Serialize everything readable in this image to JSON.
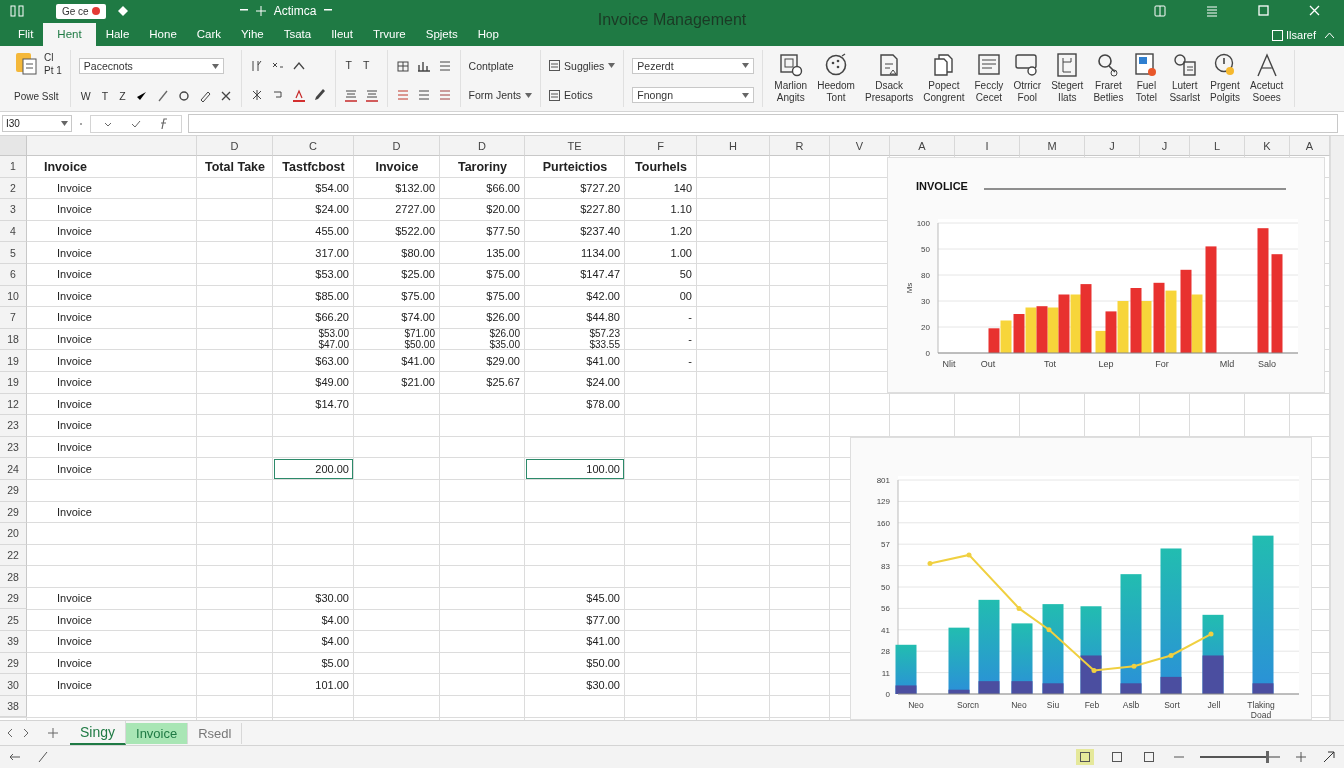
{
  "window": {
    "badge": "Ge ce",
    "document": "Actimca",
    "title": "Invoice Management"
  },
  "menu": {
    "tabs": [
      {
        "label": "Flit",
        "selected": false
      },
      {
        "label": "Hent",
        "selected": true
      },
      {
        "label": "Hale",
        "selected": false
      },
      {
        "label": "Hone",
        "selected": false
      },
      {
        "label": "Cark",
        "selected": false
      },
      {
        "label": "Yihe",
        "selected": false
      },
      {
        "label": "Tsata",
        "selected": false
      },
      {
        "label": "Ileut",
        "selected": false
      },
      {
        "label": "Trvure",
        "selected": false
      },
      {
        "label": "Spjets",
        "selected": false
      },
      {
        "label": "Hop",
        "selected": false
      }
    ],
    "account": {
      "label": "Ilsaref",
      "checked": false
    }
  },
  "ribbon": {
    "paste": {
      "label": "Powe Sslt",
      "small": [
        "Cl",
        "Pt 1"
      ]
    },
    "font": {
      "value": "Pacecnots"
    },
    "letter_buttons": [
      "W",
      "T",
      "Z"
    ],
    "type_buttons": [
      "T",
      "T"
    ],
    "style_commands": [
      {
        "label": "Contplate",
        "dropdown": false
      },
      {
        "label": "Form Jents",
        "dropdown": true
      }
    ],
    "list_commands": [
      {
        "label": "Sugglies",
        "dropdown": true
      },
      {
        "label": "Eotics",
        "dropdown": false
      }
    ],
    "selects": [
      "Pezerdt",
      "Fnongn"
    ],
    "large_buttons": [
      "Marlion\nAngits",
      "Heedom\nTont",
      "Dsack\nPresaports",
      "Popect\nCongrent",
      "Feccly\nCecet",
      "Otrricr\nFool",
      "Stegert\nIlats",
      "Fraret\nBetlies",
      "Fuel\nTotel",
      "Lutert\nSsarlst",
      "Prgent\nPolgits",
      "Acetuct\nSoees"
    ]
  },
  "formula_bar": {
    "name_box": "I30"
  },
  "table": {
    "columns": [
      "D",
      "C",
      "D",
      "D",
      "TE",
      "F",
      "H",
      "R",
      "V",
      "A",
      "I",
      "M",
      "J",
      "J",
      "L",
      "K",
      "A"
    ],
    "header": {
      "label": "1",
      "cells": [
        "Invoice",
        "Total Take",
        "Tastfcbost",
        "Invoice",
        "Taroriny",
        "Purteictios",
        "Tourhels"
      ]
    },
    "rows": [
      {
        "label": "2",
        "cells": [
          "Invoice",
          null,
          "$54.00",
          "$132.00",
          "$66.00",
          "$727.20",
          "140"
        ]
      },
      {
        "label": "3",
        "cells": [
          "Invoice",
          null,
          "$24.00",
          "2727.00",
          "$20.00",
          "$227.80",
          "1.10"
        ]
      },
      {
        "label": "4",
        "cells": [
          "Invoice",
          null,
          "455.00",
          "$522.00",
          "$77.50",
          "$237.40",
          "1.20"
        ]
      },
      {
        "label": "5",
        "cells": [
          "Invoice",
          null,
          "317.00",
          "$80.00",
          "135.00",
          "1134.00",
          "1.00"
        ]
      },
      {
        "label": "6",
        "cells": [
          "Invoice",
          null,
          "$53.00",
          "$25.00",
          "$75.00",
          "$147.47",
          "50"
        ]
      },
      {
        "label": "10",
        "cells": [
          "Invoice",
          null,
          "$85.00",
          "$75.00",
          "$75.00",
          "$42.00",
          "00"
        ]
      },
      {
        "label": "7",
        "cells": [
          "Invoice",
          null,
          "$66.20",
          "$74.00",
          "$26.00",
          "$44.80",
          "-"
        ]
      },
      {
        "label": "18",
        "cells": [
          "Invoice",
          null,
          "$53.00\n$47.00",
          "$71.00\n$50.00",
          "$26.00\n$35.00",
          "$57.23\n$33.55",
          "-"
        ]
      },
      {
        "label": "19",
        "cells": [
          "Invoice",
          null,
          "$63.00",
          "$41.00",
          "$29.00",
          "$41.00",
          "-"
        ]
      },
      {
        "label": "19",
        "cells": [
          "Invoice",
          null,
          "$49.00",
          "$21.00",
          "$25.67",
          "$24.00",
          null
        ]
      },
      {
        "label": "12",
        "cells": [
          "Invoice",
          null,
          "$14.70",
          null,
          null,
          "$78.00",
          null
        ]
      },
      {
        "label": "23",
        "cells": [
          "Invoice"
        ]
      },
      {
        "label": "23",
        "cells": [
          "Invoice"
        ]
      },
      {
        "label": "24",
        "cells": [
          "Invoice",
          null,
          {
            "text": "200.00",
            "outlined": true
          },
          null,
          null,
          {
            "text": "100.00",
            "outlined": true
          },
          null
        ]
      },
      {
        "label": "29",
        "cells": []
      },
      {
        "label": "29",
        "cells": [
          "Invoice"
        ]
      },
      {
        "label": "20",
        "cells": []
      },
      {
        "label": "22",
        "cells": []
      },
      {
        "label": "28",
        "cells": []
      },
      {
        "label": "29",
        "cells": [
          "Invoice",
          null,
          "$30.00",
          null,
          null,
          "$45.00",
          null
        ]
      },
      {
        "label": "25",
        "cells": [
          "Invoice",
          null,
          "$4.00",
          null,
          null,
          "$77.00",
          null
        ]
      },
      {
        "label": "39",
        "cells": [
          "Invoice",
          null,
          "$4.00",
          null,
          null,
          "$41.00",
          null
        ]
      },
      {
        "label": "29",
        "cells": [
          "Invoice",
          null,
          "$5.00",
          null,
          null,
          "$50.00",
          null
        ]
      },
      {
        "label": "30",
        "cells": [
          "Invoice",
          null,
          "101.00",
          null,
          null,
          "$30.00",
          null
        ]
      },
      {
        "label": "38",
        "cells": []
      }
    ]
  },
  "charts": [
    {
      "title": "INVOLICE",
      "y_title": "Ms",
      "y_axis_labels": [
        "100",
        "50",
        "80",
        "30",
        "20",
        "0"
      ],
      "x_axis_labels": [
        "Nlit",
        "Out",
        "Tot",
        "Lep",
        "For",
        "Mld",
        "Salo"
      ]
    },
    {
      "y_axis_labels": [
        "801",
        "129",
        "160",
        "57",
        "83",
        "50",
        "56",
        "41",
        "28",
        "11",
        "0"
      ],
      "x_axis_labels": [
        "Neo",
        "Sorcn",
        "Neo",
        "Siu",
        "Feb",
        "Aslb",
        "Sort",
        "Jell",
        "Tlaking Doad"
      ]
    }
  ],
  "sheet_tabs": [
    {
      "label": "Singy",
      "selected": true,
      "highlighted": false
    },
    {
      "label": "Invoice",
      "selected": false,
      "highlighted": true
    },
    {
      "label": "Rsedl",
      "selected": false,
      "highlighted": false
    }
  ],
  "status_bar": {
    "views": [
      {
        "selected": true
      },
      {
        "selected": false
      },
      {
        "selected": false
      }
    ],
    "zoom": {
      "level": 0.85
    }
  }
}
